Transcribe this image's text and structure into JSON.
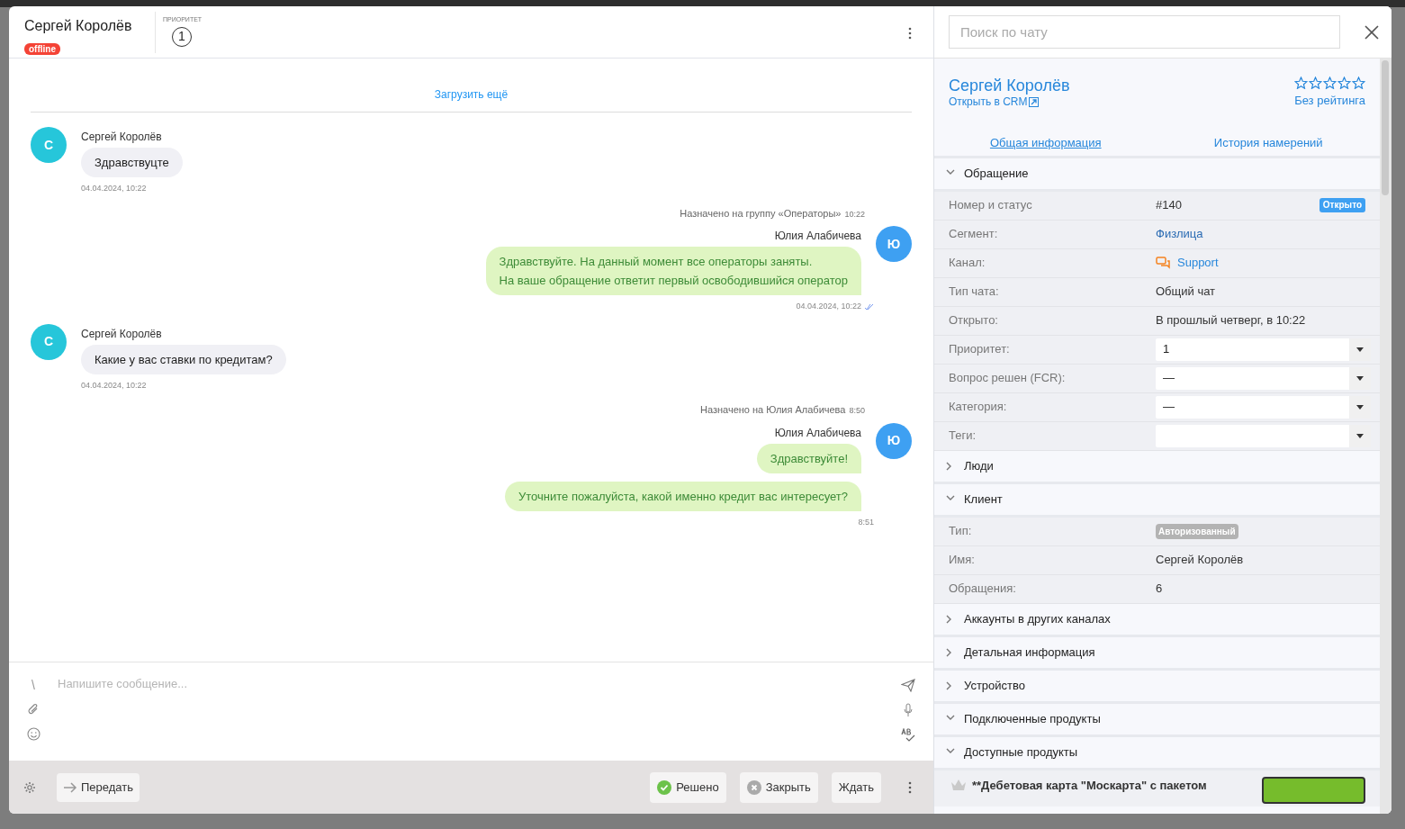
{
  "contact": {
    "name": "Сергей Королёв",
    "status": "offline",
    "online": false
  },
  "priority": {
    "label": "ПРИОРИТЕТ",
    "value": "1"
  },
  "load_more": "Загрузить ещё",
  "messages": [
    {
      "kind": "incoming",
      "author": "Сергей Королёв",
      "avatar": "С",
      "bubbles": [
        "Здравствуцте"
      ],
      "time": "04.04.2024, 10:22"
    },
    {
      "kind": "system",
      "text": "Назначено на группу «Операторы»",
      "time": "10:22"
    },
    {
      "kind": "outgoing",
      "author": "Юлия Алабичева",
      "avatar": "Ю",
      "bubbles": [
        "Здравствуйте. На данный момент все операторы заняты.\nНа ваше обращение ответит первый освободившийся оператор"
      ],
      "time": "04.04.2024, 10:22",
      "read": true
    },
    {
      "kind": "incoming",
      "author": "Сергей Королёв",
      "avatar": "С",
      "bubbles": [
        "Какие у вас ставки по кредитам?"
      ],
      "time": "04.04.2024, 10:22"
    },
    {
      "kind": "system",
      "text": "Назначено на Юлия Алабичева",
      "time": "8:50"
    },
    {
      "kind": "outgoing",
      "author": "Юлия Алабичева",
      "avatar": "Ю",
      "bubbles": [
        "Здравствуйте!",
        "Уточните пожалуйста, какой именно кредит вас интересует?"
      ],
      "time": "8:51",
      "read": false
    }
  ],
  "composer": {
    "command_hint": "\\",
    "placeholder": "Напишите сообщение..."
  },
  "transfer": "Передать",
  "actions": [
    {
      "kind": "resolve",
      "label": "Решено"
    },
    {
      "kind": "close",
      "label": "Закрыть"
    },
    {
      "kind": "wait",
      "label": "Ждать"
    }
  ],
  "search": {
    "placeholder": "Поиск по чату"
  },
  "profile": {
    "name": "Сергей Королёв",
    "crm_link": "Открыть в CRM",
    "stars": 0,
    "rating": "Без рейтинга"
  },
  "tabs": [
    {
      "label": "Общая информация",
      "selected": true
    },
    {
      "label": "История намерений",
      "selected": false
    }
  ],
  "sections": [
    {
      "title": "Обращение",
      "expanded": true,
      "rows": [
        {
          "kind": "number_status",
          "label": "Номер и статус",
          "value": "#140",
          "badge": "Открыто"
        },
        {
          "kind": "link",
          "label": "Сегмент:",
          "value": "Физлица"
        },
        {
          "kind": "channel",
          "label": "Канал:",
          "value": "Support"
        },
        {
          "kind": "text",
          "label": "Тип чата:",
          "value": "Общий чат"
        },
        {
          "kind": "text",
          "label": "Открыто:",
          "value": "В прошлый четверг, в 10:22"
        },
        {
          "kind": "select",
          "label": "Приоритет:",
          "value": "1"
        },
        {
          "kind": "select",
          "label": "Вопрос решен (FCR):",
          "value": "—"
        },
        {
          "kind": "select",
          "label": "Категория:",
          "value": "—"
        },
        {
          "kind": "select",
          "label": "Теги:"
        }
      ]
    },
    {
      "title": "Люди",
      "expanded": false
    },
    {
      "title": "Клиент",
      "expanded": true,
      "rows": [
        {
          "kind": "tag",
          "label": "Тип:",
          "value": "Авторизованный"
        },
        {
          "kind": "text",
          "label": "Имя:",
          "value": "Сергей Королёв"
        },
        {
          "kind": "text",
          "label": "Обращения:",
          "value": "6"
        }
      ]
    },
    {
      "title": "Аккаунты в других каналах",
      "expanded": false
    },
    {
      "title": "Детальная информация",
      "expanded": false
    },
    {
      "title": "Устройство",
      "expanded": false
    },
    {
      "title": "Подключенные продукты",
      "expanded": true
    },
    {
      "title": "Доступные продукты",
      "expanded": true,
      "products": [
        "**Дебетовая карта \"Москарта\" с пакетом"
      ]
    }
  ]
}
